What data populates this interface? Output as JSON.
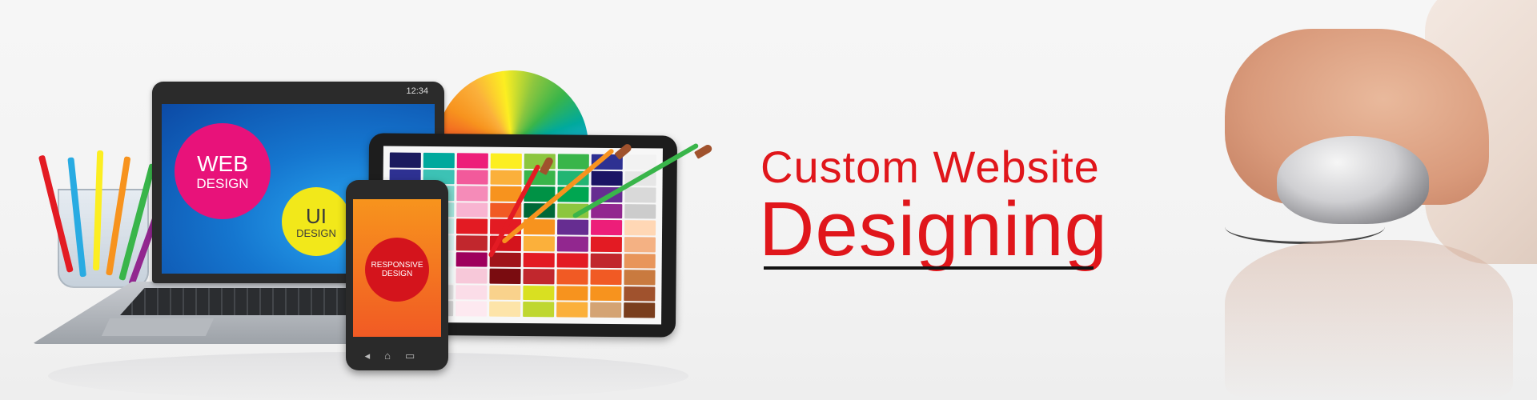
{
  "laptop": {
    "status_time": "12:34",
    "web_circle": {
      "line1": "WEB",
      "line2": "DESIGN"
    },
    "ui_circle": {
      "line1": "UI",
      "line2": "DESIGN"
    }
  },
  "phone": {
    "circle": {
      "line1": "RESPONSIVE",
      "line2": "DESIGN"
    }
  },
  "headline": {
    "line1": "Custom Website",
    "line2": "Designing"
  },
  "colors": {
    "headline": "#e0161b",
    "web_circle": "#e8127a",
    "ui_circle": "#f2e81a",
    "responsive_circle": "#d4141c"
  }
}
